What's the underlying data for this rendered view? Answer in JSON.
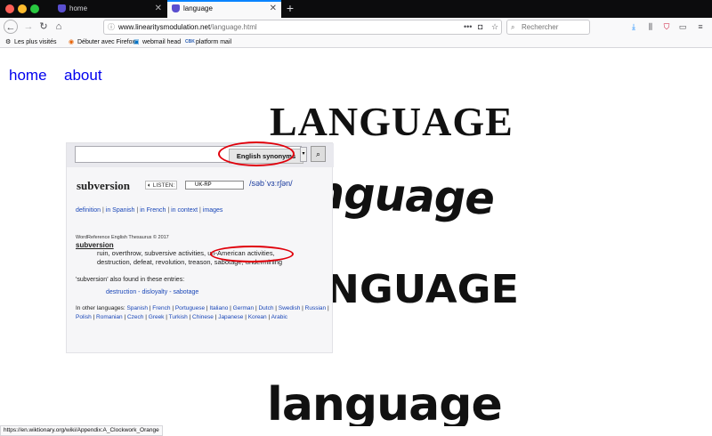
{
  "browser": {
    "tabs": [
      {
        "title": "home",
        "active": false
      },
      {
        "title": "language",
        "active": true
      }
    ],
    "url": {
      "domain": "www.linearitysmodulation.net",
      "path": "/language.html"
    },
    "search_placeholder": "Rechercher",
    "bookmarks": [
      "Les plus visités",
      "Débuter avec Firefox",
      "webmail head",
      "platform mail"
    ],
    "status_url": "https://en.wiktionary.org/wiki/Appendix:A_Clockwork_Orange",
    "icons": {
      "back": "back-arrow-icon",
      "forward": "forward-arrow-icon",
      "reload": "reload-icon",
      "home": "home-icon"
    }
  },
  "page": {
    "nav": {
      "home": "home",
      "about": "about"
    },
    "words": [
      "LANGUAGE",
      "language",
      "LANGUAGE",
      "language"
    ]
  },
  "dictionary": {
    "dict_select": "English synonyms",
    "headword": "subversion",
    "listen_label": "LISTEN:",
    "accent": "UK-RP",
    "ipa": "/səbˈvɜːrʃən/",
    "links": [
      "definition",
      "in Spanish",
      "in French",
      "in context",
      "images"
    ],
    "copyright": "WordReference English Thesaurus © 2017",
    "entry": "subversion",
    "synonyms_line1": "ruin, overthrow, subversive activities, un-American activities,",
    "synonyms_line2": "destruction, defeat, revolution, treason, sabotage, undermining",
    "found_label": "'subversion' also found in these entries:",
    "found_entries": "destruction - disloyalty - sabotage",
    "other_lang_label": "In other languages:",
    "other_langs": [
      "Spanish",
      "French",
      "Portuguese",
      "Italiano",
      "German",
      "Dutch",
      "Swedish",
      "Russian",
      "Polish",
      "Romanian",
      "Czech",
      "Greek",
      "Turkish",
      "Chinese",
      "Japanese",
      "Korean",
      "Arabic"
    ]
  },
  "colors": {
    "link": "#0000ee",
    "annotation": "#e0000b",
    "tab_accent": "#0a84ff"
  }
}
